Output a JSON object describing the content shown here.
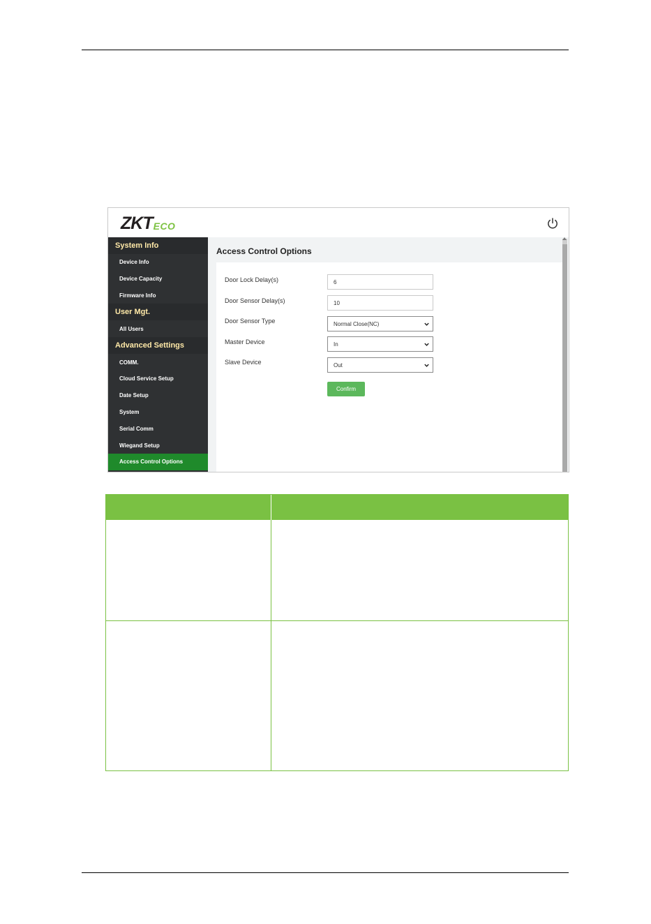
{
  "app": {
    "logo_main": "ZKT",
    "logo_sub": "ECO",
    "content_title": "Access Control Options"
  },
  "sidebar": {
    "sections": [
      {
        "title": "System Info",
        "items": [
          "Device Info",
          "Device Capacity",
          "Firmware Info"
        ]
      },
      {
        "title": "User Mgt.",
        "items": [
          "All Users"
        ]
      },
      {
        "title": "Advanced Settings",
        "items": [
          "COMM.",
          "Cloud Service Setup",
          "Date Setup",
          "System",
          "Serial Comm",
          "Wiegand Setup",
          "Access Control Options"
        ]
      }
    ],
    "active_item": "Access Control Options"
  },
  "form": {
    "door_lock_delay_label": "Door Lock Delay(s)",
    "door_lock_delay_value": "6",
    "door_sensor_delay_label": "Door Sensor Delay(s)",
    "door_sensor_delay_value": "10",
    "door_sensor_type_label": "Door Sensor Type",
    "door_sensor_type_value": "Normal Close(NC)",
    "master_device_label": "Master Device",
    "master_device_value": "In",
    "slave_device_label": "Slave Device",
    "slave_device_value": "Out",
    "confirm_label": "Confirm"
  },
  "colors": {
    "table_accent": "#7ac143",
    "active_nav": "#1f8a2b",
    "confirm_button": "#5cb85c",
    "sidebar_bg": "#2f3133",
    "section_title": "#ffe9a8"
  }
}
